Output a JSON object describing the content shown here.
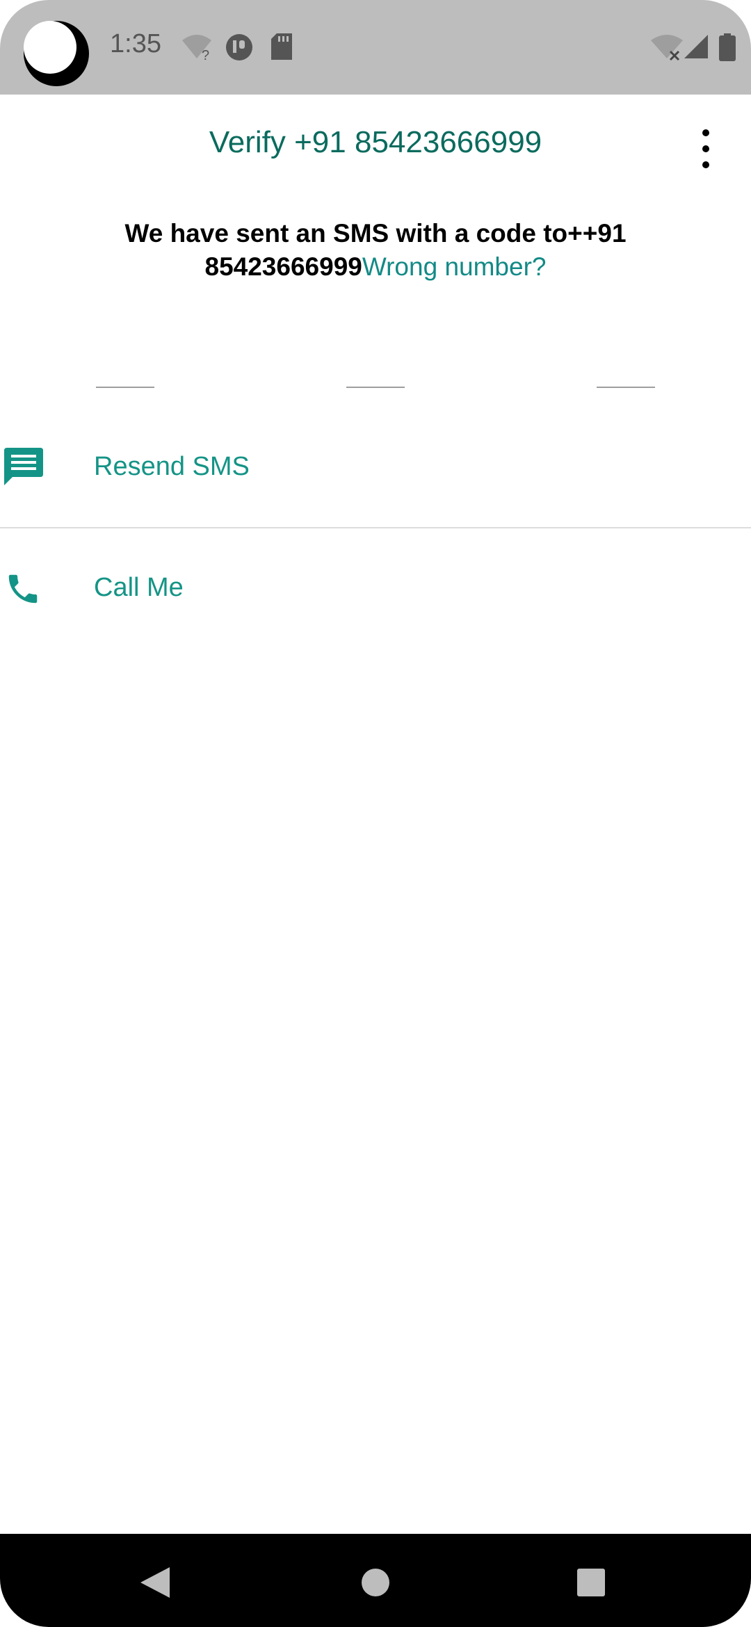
{
  "status_bar": {
    "time": "1:35",
    "icons": [
      "wifi-unknown-icon",
      "data-saver-icon",
      "sd-card-icon",
      "wifi-off-icon",
      "cell-signal-icon",
      "battery-icon"
    ]
  },
  "app_bar": {
    "title": "Verify +91 85423666999",
    "menu_icon": "more-vert-icon"
  },
  "message": {
    "text": "We have sent an SMS with a code to++91 85423666999",
    "link": "Wrong number?"
  },
  "code_input": {
    "fields": [
      "",
      "",
      ""
    ]
  },
  "actions": {
    "resend_sms": {
      "label": "Resend SMS",
      "icon": "sms-icon"
    },
    "call_me": {
      "label": "Call Me",
      "icon": "phone-icon"
    }
  },
  "nav_bar": {
    "buttons": [
      "back-icon",
      "home-icon",
      "recents-icon"
    ]
  },
  "colors": {
    "title": "#0a6b5e",
    "accent": "#149486",
    "link": "#138a86",
    "status_bar_bg": "#bdbdbd"
  }
}
